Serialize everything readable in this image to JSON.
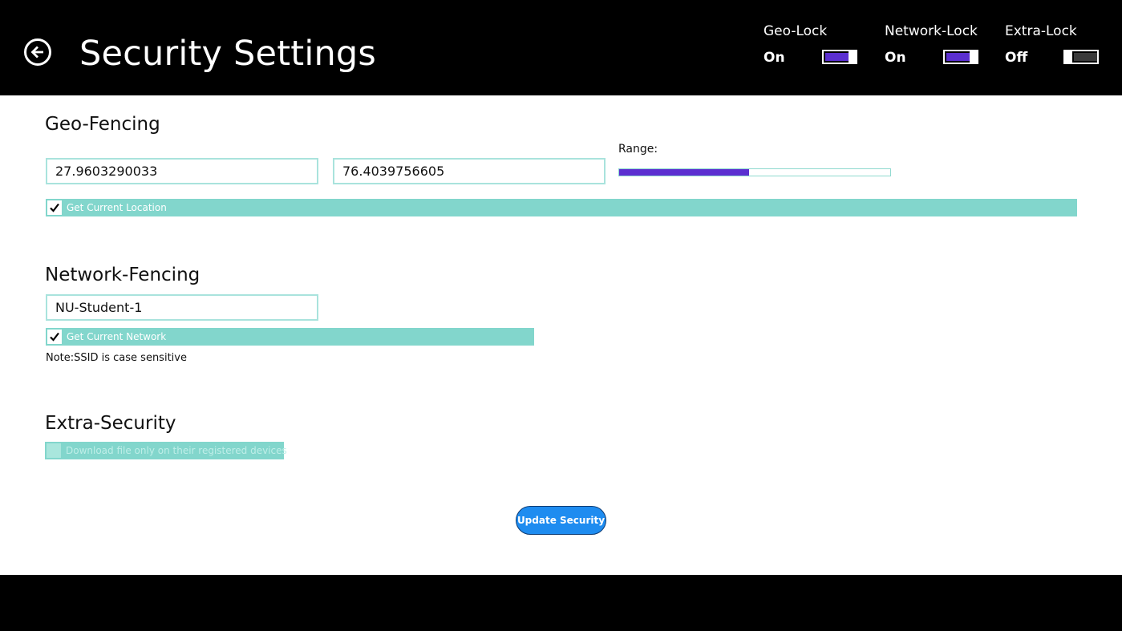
{
  "header": {
    "title": "Security Settings",
    "back_icon": "arrow-left-circle-icon",
    "toggles": [
      {
        "label": "Geo-Lock",
        "state": "On",
        "on": true
      },
      {
        "label": "Network-Lock",
        "state": "On",
        "on": true
      },
      {
        "label": "Extra-Lock",
        "state": "Off",
        "on": false
      }
    ]
  },
  "geo": {
    "title": "Geo-Fencing",
    "latitude": "27.9603290033",
    "longitude": "76.4039756605",
    "range_label": "Range:",
    "range_fraction": 0.48,
    "get_location_label": "Get Current Location",
    "get_location_checked": true
  },
  "network": {
    "title": "Network-Fencing",
    "ssid": "NU-Student-1",
    "get_network_label": "Get Current Network",
    "get_network_checked": true,
    "note": "Note:SSID is case sensitive"
  },
  "extra": {
    "title": "Extra-Security",
    "registered_devices_label": "Download file only on their registered devices",
    "registered_devices_checked": false,
    "disabled": true
  },
  "actions": {
    "update_label": "Update Security"
  },
  "colors": {
    "topbar": "#000000",
    "accent_purple": "#5b2fd0",
    "teal_bar": "#82d6cc",
    "input_border": "#a9e3dd",
    "button_blue": "#1e8cf0",
    "toggle_off": "#3a3a3a"
  }
}
